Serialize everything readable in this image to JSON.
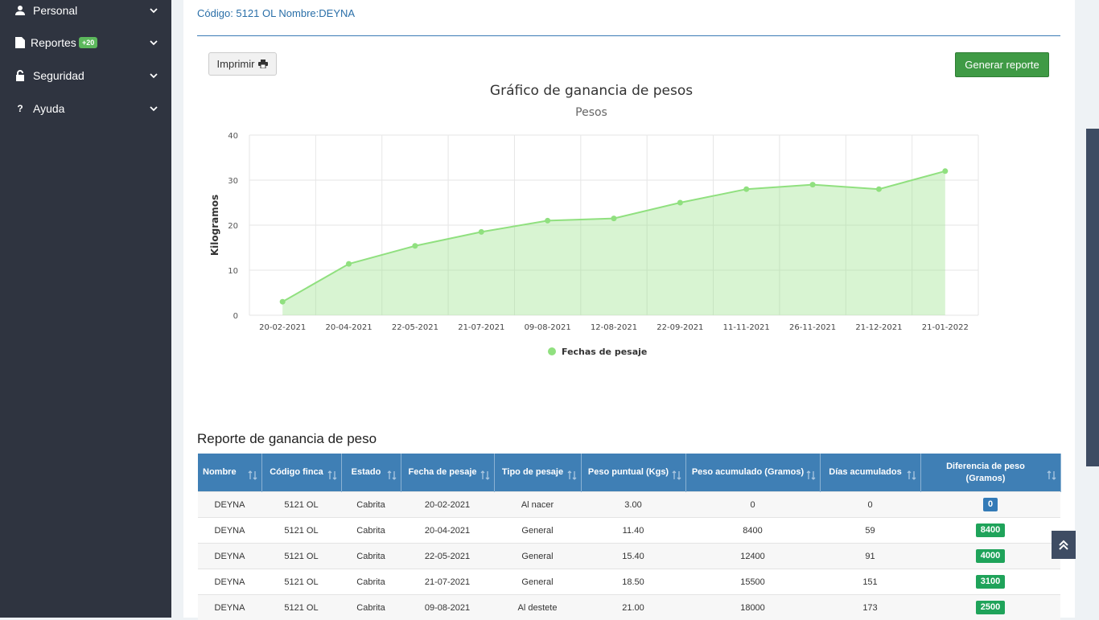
{
  "sidebar": {
    "items": [
      {
        "label": "Personal",
        "icon": "users-icon"
      },
      {
        "label": "Reportes",
        "icon": "file-icon",
        "badge": "+20"
      },
      {
        "label": "Seguridad",
        "icon": "lock-icon"
      },
      {
        "label": "Ayuda",
        "icon": "question-icon"
      }
    ]
  },
  "header": {
    "line": "Código: 5121 OL Nombre:DEYNA"
  },
  "toolbar": {
    "print_label": "Imprimir",
    "generate_label": "Generar reporte"
  },
  "chart_data": {
    "type": "area",
    "title": "Gráfico de ganancia de pesos",
    "subtitle": "Pesos",
    "ylabel": "Kilogramos",
    "ylim": [
      0,
      40
    ],
    "yticks": [
      0,
      10,
      20,
      30,
      40
    ],
    "grid": true,
    "legend_position": "bottom",
    "categories": [
      "20-02-2021",
      "20-04-2021",
      "22-05-2021",
      "21-07-2021",
      "09-08-2021",
      "12-08-2021",
      "22-09-2021",
      "11-11-2021",
      "26-11-2021",
      "21-12-2021",
      "21-01-2022"
    ],
    "series": [
      {
        "name": "Fechas de pesaje",
        "color": "#90e07f",
        "values": [
          3.0,
          11.4,
          15.4,
          18.5,
          21.0,
          21.5,
          25.0,
          28.0,
          29.0,
          28.0,
          32.0
        ]
      }
    ]
  },
  "report": {
    "title": "Reporte de ganancia de peso",
    "columns": [
      "Nombre",
      "Código finca",
      "Estado",
      "Fecha de pesaje",
      "Tipo de pesaje",
      "Peso puntual (Kgs)",
      "Peso acumulado (Gramos)",
      "Días acumulados",
      "Diferencia de peso (Gramos)"
    ],
    "rows": [
      [
        "DEYNA",
        "5121 OL",
        "Cabrita",
        "20-02-2021",
        "Al nacer",
        "3.00",
        "0",
        "0",
        "0"
      ],
      [
        "DEYNA",
        "5121 OL",
        "Cabrita",
        "20-04-2021",
        "General",
        "11.40",
        "8400",
        "59",
        "8400"
      ],
      [
        "DEYNA",
        "5121 OL",
        "Cabrita",
        "22-05-2021",
        "General",
        "15.40",
        "12400",
        "91",
        "4000"
      ],
      [
        "DEYNA",
        "5121 OL",
        "Cabrita",
        "21-07-2021",
        "General",
        "18.50",
        "15500",
        "151",
        "3100"
      ],
      [
        "DEYNA",
        "5121 OL",
        "Cabrita",
        "09-08-2021",
        "Al destete",
        "21.00",
        "18000",
        "173",
        "2500"
      ]
    ]
  },
  "colors": {
    "sidebar": "#2f3440",
    "accent": "#3f7fb5",
    "primary_button": "#3f9a45",
    "badge_green": "#1fa35a",
    "badge_blue": "#337ab7"
  }
}
